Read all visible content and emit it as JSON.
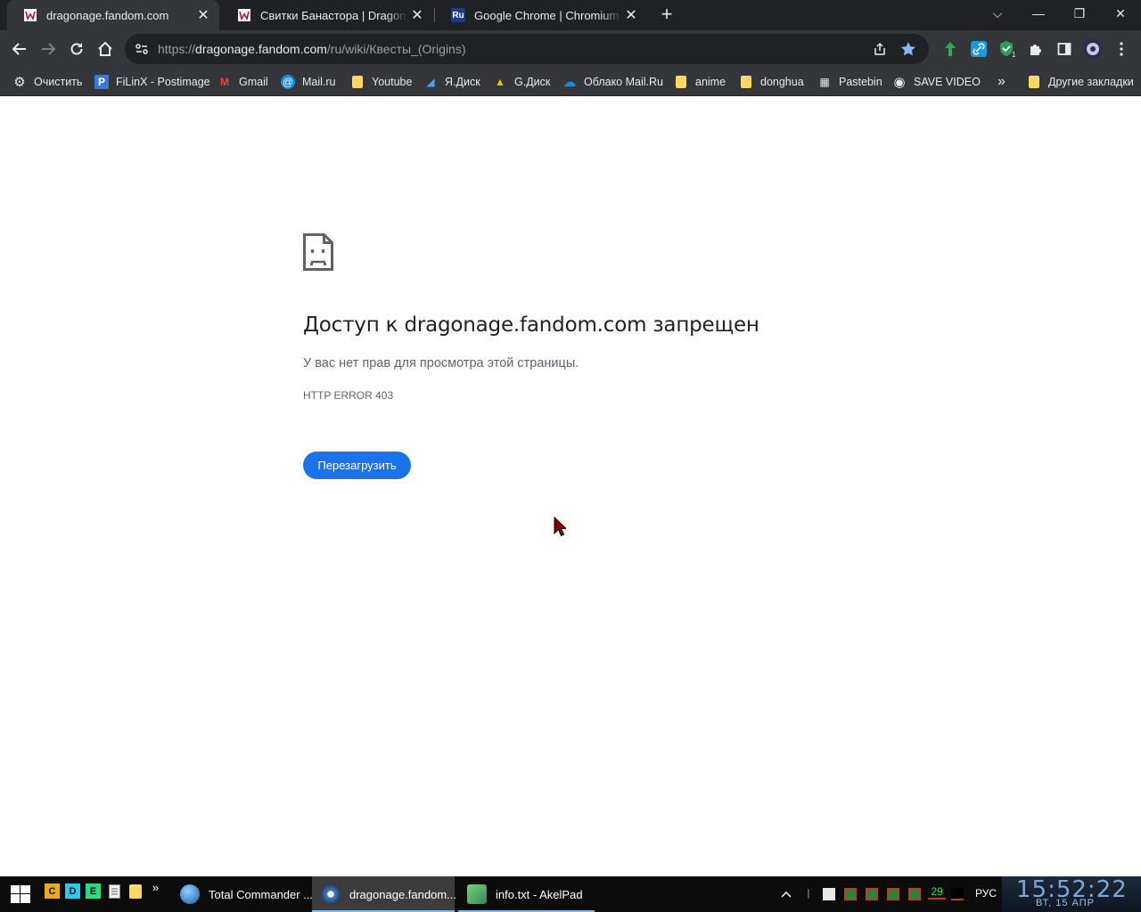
{
  "browser": {
    "tabs": [
      {
        "title": "dragonage.fandom.com",
        "favicon": "fandom-icon",
        "active": true
      },
      {
        "title": "Свитки Банастора | Dragon Age",
        "favicon": "fandom-icon",
        "active": false
      },
      {
        "title": "Google Chrome | Chromium | SF",
        "favicon": "ru-board-icon",
        "favicon_text": "Ru",
        "active": false
      }
    ],
    "close_glyph": "✕",
    "new_tab_glyph": "+",
    "window_controls": {
      "dropdown": "⌵",
      "minimize": "—",
      "restore": "❐",
      "close": "✕"
    },
    "address": {
      "scheme": "https://",
      "host": "dragonage.fandom.com",
      "path": "/ru/wiki/Квесты_(Origins)"
    },
    "bookmarks": [
      {
        "label": "Очистить",
        "icon": "gear-icon",
        "glyph": "⚙"
      },
      {
        "label": "FiLinX - Postimage",
        "icon": "postimage-icon",
        "glyph": "P"
      },
      {
        "label": "Gmail",
        "icon": "gmail-icon",
        "glyph": "M"
      },
      {
        "label": "Mail.ru",
        "icon": "mailru-icon",
        "glyph": "@"
      },
      {
        "label": "Youtube",
        "icon": "folder-icon"
      },
      {
        "label": "Я.Диск",
        "icon": "yandex-disk-icon",
        "glyph": "◢"
      },
      {
        "label": "G.Диск",
        "icon": "google-drive-icon",
        "glyph": "▲"
      },
      {
        "label": "Облако Mail.Ru",
        "icon": "cloud-icon",
        "glyph": "☁"
      },
      {
        "label": "anime",
        "icon": "folder-icon"
      },
      {
        "label": "donghua",
        "icon": "folder-icon"
      },
      {
        "label": "Pastebin",
        "icon": "pastebin-icon",
        "glyph": "▦"
      },
      {
        "label": "SAVE VIDEO",
        "icon": "globe-icon",
        "glyph": "◉"
      }
    ],
    "bookmarks_overflow": "»",
    "other_bookmarks": "Другие закладки"
  },
  "error_page": {
    "title": "Доступ к dragonage.fandom.com запрещен",
    "description": "У вас нет прав для просмотра этой страницы.",
    "code": "HTTP ERROR 403",
    "reload_label": "Перезагрузить"
  },
  "taskbar": {
    "quick_launch": [
      "C",
      "D",
      "E"
    ],
    "overflow": "»",
    "tasks": [
      {
        "label": "Total Commander ...",
        "active": false
      },
      {
        "label": "dragonage.fandom...",
        "active": true
      },
      {
        "label": "info.txt - AkelPad",
        "active": false
      }
    ],
    "tray_number": "29",
    "language": "РУС",
    "time": "15:52:22",
    "date": "ВТ, 15  АПР"
  },
  "colors": {
    "accent": "#1a73e8",
    "tab_strip": "#202124",
    "toolbar": "#35363a"
  }
}
